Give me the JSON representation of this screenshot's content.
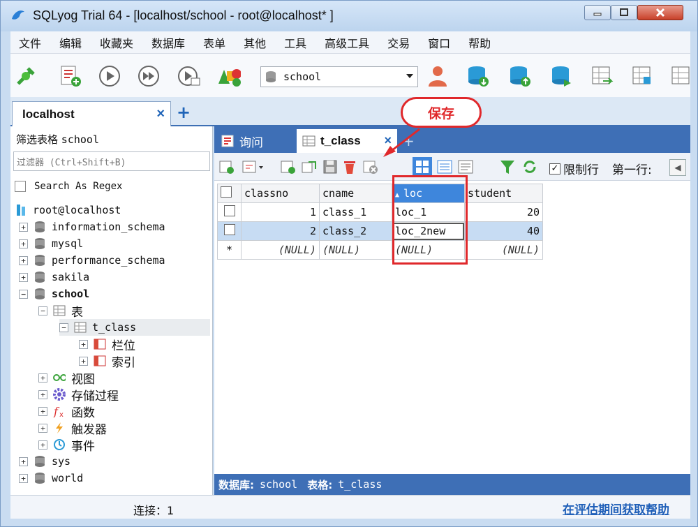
{
  "window": {
    "title": "SQLyog Trial 64 - [localhost/school - root@localhost* ]"
  },
  "menu": [
    "文件",
    "编辑",
    "收藏夹",
    "数据库",
    "表单",
    "其他",
    "工具",
    "高级工具",
    "交易",
    "窗口",
    "帮助"
  ],
  "toolbar": {
    "db_selected": "school"
  },
  "connection_tab": {
    "label": "localhost",
    "close": "×",
    "add": "+"
  },
  "left_panel": {
    "filter_label": "筛选表格",
    "filter_db": "school",
    "filter_placeholder": "过滤器 (Ctrl+Shift+B)",
    "regex_label": "Search As Regex",
    "tree": {
      "root": "root@localhost",
      "dbs": {
        "information_schema": "information_schema",
        "mysql": "mysql",
        "performance_schema": "performance_schema",
        "sakila": "sakila",
        "school": "school",
        "sys": "sys",
        "world": "world"
      },
      "school_children": {
        "tables": "表",
        "t_class": "t_class",
        "columns": "栏位",
        "indexes": "索引",
        "views": "视图",
        "procedures": "存储过程",
        "functions": "函数",
        "triggers": "触发器",
        "events": "事件"
      }
    }
  },
  "right_panel": {
    "tabs": {
      "query": "询问",
      "table": "t_class",
      "close": "×",
      "add": "+"
    },
    "limit_rows_label": "限制行",
    "first_row_label": "第一行:",
    "grid": {
      "columns": [
        "classno",
        "cname",
        "loc",
        "student"
      ],
      "rows": [
        {
          "classno": "1",
          "cname": "class_1",
          "loc": "loc_1",
          "student": "20"
        },
        {
          "classno": "2",
          "cname": "class_2",
          "loc": "loc_2new",
          "student": "40"
        }
      ],
      "new_row_marker": "*",
      "null_text": "(NULL)"
    },
    "status": {
      "db_label": "数据库:",
      "db_value": "school",
      "table_label": "表格:",
      "table_value": "t_class"
    }
  },
  "statusbar": {
    "connections": "连接：1",
    "help_link": "在评估期间获取帮助"
  },
  "annotation": {
    "callout": "保存"
  },
  "colors": {
    "accent_blue": "#3e6fb6",
    "sorted_header": "#3e86dc",
    "annotation_red": "#e0282b"
  }
}
